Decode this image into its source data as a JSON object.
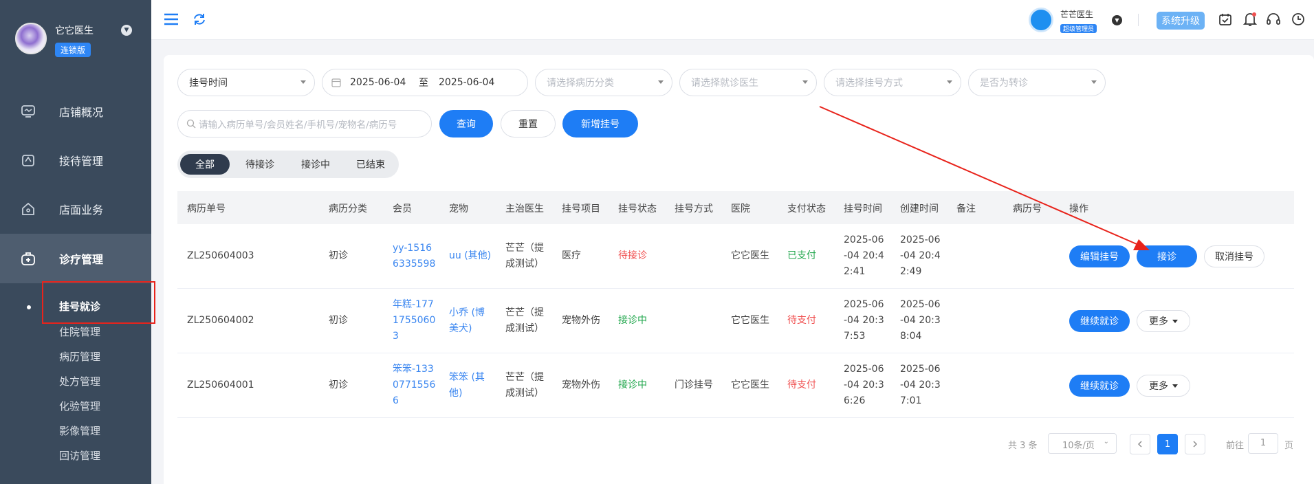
{
  "brand": {
    "name": "它它医生",
    "edition": "连锁版"
  },
  "sidebar": {
    "items": [
      {
        "label": "店铺概况",
        "icon": "dashboard-icon"
      },
      {
        "label": "接待管理",
        "icon": "reception-icon"
      },
      {
        "label": "店面业务",
        "icon": "store-icon"
      },
      {
        "label": "诊疗管理",
        "icon": "medical-kit-icon"
      }
    ],
    "sub_items": [
      "挂号就诊",
      "住院管理",
      "病历管理",
      "处方管理",
      "化验管理",
      "影像管理",
      "回访管理"
    ]
  },
  "header": {
    "user_name": "芒芒医生",
    "user_role": "超级管理员",
    "upgrade_label": "系统升级",
    "icons": [
      "calendar-check-icon",
      "bell-icon",
      "headset-icon",
      "clock-icon"
    ]
  },
  "filters": {
    "time_type": "挂号时间",
    "date_start": "2025-06-04",
    "date_sep": "至",
    "date_end": "2025-06-04",
    "category_placeholder": "请选择病历分类",
    "doctor_placeholder": "请选择就诊医生",
    "method_placeholder": "请选择挂号方式",
    "transfer_placeholder": "是否为转诊",
    "search_placeholder": "请输入病历单号/会员姓名/手机号/宠物名/病历号",
    "query_label": "查询",
    "reset_label": "重置",
    "new_label": "新增挂号"
  },
  "tabs": [
    "全部",
    "待接诊",
    "接诊中",
    "已结束"
  ],
  "table": {
    "headers": [
      "病历单号",
      "病历分类",
      "会员",
      "宠物",
      "主治医生",
      "挂号项目",
      "挂号状态",
      "挂号方式",
      "医院",
      "支付状态",
      "挂号时间",
      "创建时间",
      "备注",
      "病历号",
      "操作"
    ],
    "rows": [
      {
        "no": "ZL250604003",
        "category": "初诊",
        "member": [
          "yy-1516",
          "6335598"
        ],
        "pet": [
          "uu (其他)"
        ],
        "doctor": [
          "芒芒（提",
          "成测试）"
        ],
        "item": "医疗",
        "status": "待接诊",
        "method": "",
        "hospital": "它它医生",
        "pay": "已支付",
        "reg_time": [
          "2025-06",
          "-04 20:4",
          "2:41"
        ],
        "create_time": [
          "2025-06",
          "-04 20:4",
          "2:49"
        ],
        "ops": [
          "编辑挂号",
          "接诊",
          "取消挂号"
        ]
      },
      {
        "no": "ZL250604002",
        "category": "初诊",
        "member": [
          "年糕-177",
          "1755060",
          "3"
        ],
        "pet": [
          "小乔 (博",
          "美犬)"
        ],
        "doctor": [
          "芒芒（提",
          "成测试）"
        ],
        "item": "宠物外伤",
        "status": "接诊中",
        "method": "",
        "hospital": "它它医生",
        "pay": "待支付",
        "reg_time": [
          "2025-06",
          "-04 20:3",
          "7:53"
        ],
        "create_time": [
          "2025-06",
          "-04 20:3",
          "8:04"
        ],
        "ops": [
          "继续就诊",
          "更多"
        ]
      },
      {
        "no": "ZL250604001",
        "category": "初诊",
        "member": [
          "笨笨-133",
          "0771556",
          "6"
        ],
        "pet": [
          "笨笨 (其",
          "他)"
        ],
        "doctor": [
          "芒芒（提",
          "成测试）"
        ],
        "item": "宠物外伤",
        "status": "接诊中",
        "method": "门诊挂号",
        "hospital": "它它医生",
        "pay": "待支付",
        "reg_time": [
          "2025-06",
          "-04 20:3",
          "6:26"
        ],
        "create_time": [
          "2025-06",
          "-04 20:3",
          "7:01"
        ],
        "ops": [
          "继续就诊",
          "更多"
        ]
      }
    ]
  },
  "pagination": {
    "total": "共 3 条",
    "page_size": "10条/页",
    "current": "1",
    "goto_label": "前往",
    "goto_value": "1",
    "page_suffix": "页"
  }
}
